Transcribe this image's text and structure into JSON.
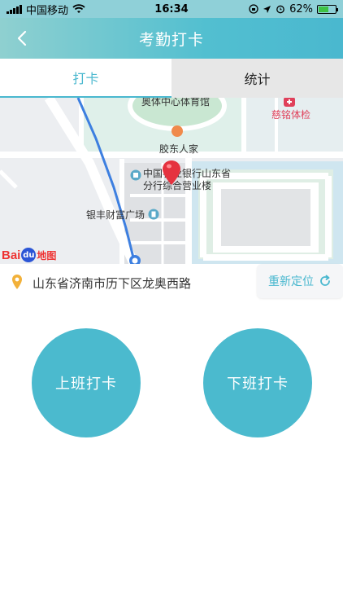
{
  "status_bar": {
    "carrier": "中国移动",
    "time": "16:34",
    "battery": "62%",
    "battery_level": 0.62
  },
  "nav": {
    "title": "考勤打卡",
    "back_icon": "chevron-left-icon"
  },
  "tabs": [
    {
      "label": "打卡",
      "active": true
    },
    {
      "label": "统计",
      "active": false
    }
  ],
  "map": {
    "labels": {
      "stadium": "奥体中心体育馆",
      "health": "慈铭体检",
      "restaurant": "胶东人家",
      "bank_line1": "中国农业银行山东省",
      "bank_line2": "分行综合营业楼",
      "plaza": "银丰财富广场"
    },
    "logo_text": "Bai",
    "logo_du": "du",
    "logo_suffix": "地图"
  },
  "location": {
    "address": "山东省济南市历下区龙奥西路",
    "relocate_label": "重新定位"
  },
  "actions": {
    "punch_in": "上班打卡",
    "punch_out": "下班打卡"
  },
  "colors": {
    "accent": "#4bbace",
    "nav_start": "#8fd0d0",
    "nav_end": "#4ab8cf",
    "marker_red": "#e5323f"
  }
}
